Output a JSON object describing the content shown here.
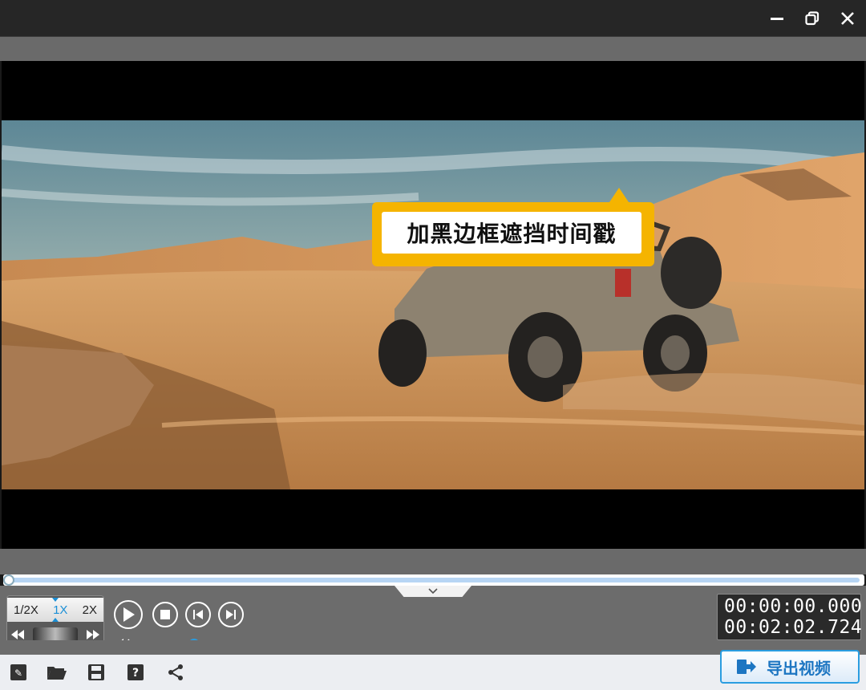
{
  "window": {
    "icons": [
      "minimize-icon",
      "restore-icon",
      "close-icon"
    ]
  },
  "video": {
    "overlay_caption": "加黑边框遮挡时间戳",
    "caption_color": "#f5b400"
  },
  "playback": {
    "speed_options": [
      "1/2X",
      "1X",
      "2X"
    ],
    "active_speed": "1X",
    "progress": 0.0,
    "volume": 0.6
  },
  "timecode": {
    "current": "00:00:00.000",
    "total": "00:02:02.724"
  },
  "toolbar": {
    "icons": [
      "edit-icon",
      "folder-open-icon",
      "save-icon",
      "help-icon",
      "share-icon"
    ]
  },
  "export": {
    "label": "导出视频"
  },
  "colors": {
    "accent": "#2a9de0",
    "title_bar": "#262626",
    "panel": "#6c6c6c"
  }
}
